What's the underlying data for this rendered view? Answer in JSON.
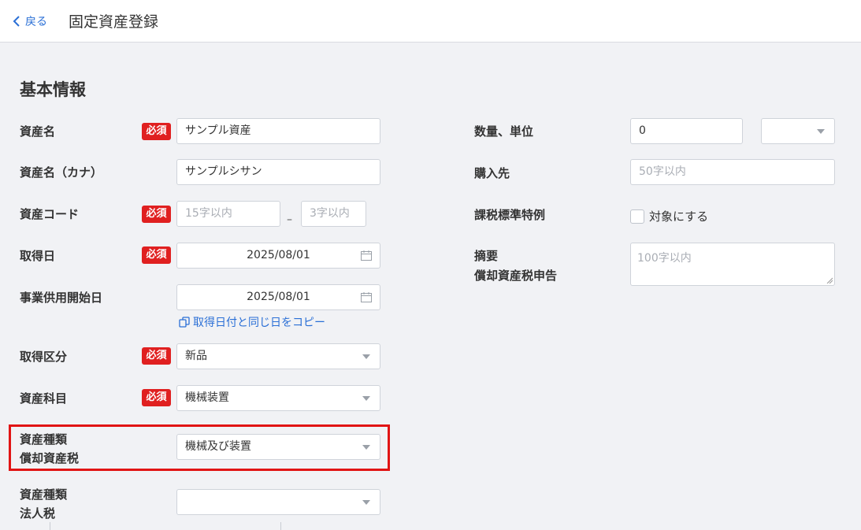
{
  "header": {
    "back_label": "戻る",
    "title": "固定資産登録"
  },
  "section": {
    "title": "基本情報"
  },
  "required_label": "必須",
  "left": {
    "asset_name": {
      "label": "資産名",
      "value": "サンプル資産"
    },
    "asset_name_kana": {
      "label": "資産名（カナ）",
      "value": "サンプルシサン"
    },
    "asset_code": {
      "label": "資産コード",
      "placeholder1": "15字以内",
      "separator": "–",
      "placeholder2": "3字以内"
    },
    "acquisition_date": {
      "label": "取得日",
      "value": "2025/08/01"
    },
    "service_start_date": {
      "label": "事業供用開始日",
      "value": "2025/08/01",
      "copy_link": "取得日付と同じ日をコピー"
    },
    "acquisition_type": {
      "label": "取得区分",
      "value": "新品"
    },
    "account_item": {
      "label": "資産科目",
      "value": "機械装置"
    },
    "asset_type_depreciable": {
      "label_line1": "資産種類",
      "label_line2": "償却資産税",
      "value": "機械及び装置"
    },
    "asset_type_corporate": {
      "label_line1": "資産種類",
      "label_line2": "法人税",
      "value": ""
    }
  },
  "right": {
    "quantity": {
      "label": "数量、単位",
      "value": "0",
      "unit": ""
    },
    "supplier": {
      "label": "購入先",
      "placeholder": "50字以内"
    },
    "tax_special": {
      "label": "課税標準特例",
      "checkbox_label": "対象にする",
      "checked": false
    },
    "summary": {
      "label_line1": "摘要",
      "label_line2": "償却資産税申告",
      "placeholder": "100字以内"
    }
  },
  "colors": {
    "accent": "#2a6fd6",
    "required": "#e02020",
    "highlight": "#e11414"
  },
  "icons": {
    "back": "chevron-left-icon",
    "calendar": "calendar-icon",
    "copy": "copy-icon",
    "dropdown": "caret-down-icon"
  }
}
